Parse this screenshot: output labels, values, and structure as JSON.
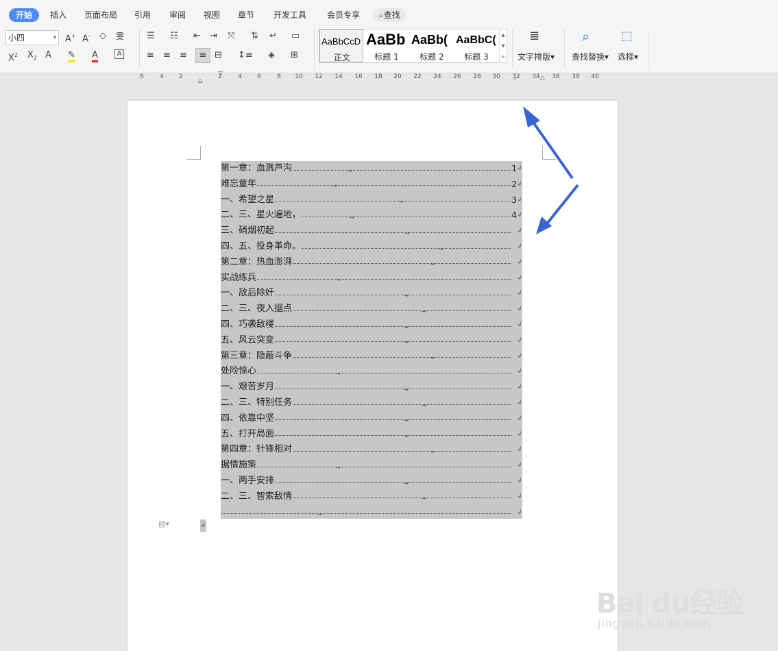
{
  "tabs": [
    {
      "label": "开始",
      "active": true
    },
    {
      "label": "插入"
    },
    {
      "label": "页面布局"
    },
    {
      "label": "引用"
    },
    {
      "label": "审阅"
    },
    {
      "label": "视图"
    },
    {
      "label": "章节"
    },
    {
      "label": "开发工具"
    },
    {
      "label": "会员专享"
    },
    {
      "label": "查找"
    }
  ],
  "ribbon": {
    "font_size_value": "小四",
    "styles": [
      {
        "preview": "AaBbCcD",
        "name": "正文"
      },
      {
        "preview": "AaBb",
        "name": "标题 1"
      },
      {
        "preview": "AaBb(",
        "name": "标题 2"
      },
      {
        "preview": "AaBbC(",
        "name": "标题 3"
      }
    ],
    "text_layout_label": "文字排版",
    "find_replace_label": "查找替换",
    "select_label": "选择"
  },
  "ruler": {
    "numbers": [
      "6",
      "4",
      "2",
      "2",
      "4",
      "6",
      "8",
      "10",
      "12",
      "14",
      "16",
      "18",
      "20",
      "22",
      "24",
      "26",
      "28",
      "30",
      "32",
      "34",
      "36",
      "38",
      "40"
    ]
  },
  "toc": {
    "lines": [
      {
        "text": "第一章：血溅芦沟",
        "page": "1"
      },
      {
        "text": "难忘童年",
        "page": "2"
      },
      {
        "text": "一、希望之星",
        "page": "3"
      },
      {
        "text": "二、三、星火遍地，",
        "page": "4"
      },
      {
        "text": "三、硝烟初起",
        "page": ""
      },
      {
        "text": "四、五、投身革命。",
        "page": ""
      },
      {
        "text": "第二章：热血澎湃",
        "page": ""
      },
      {
        "text": "实战练兵",
        "page": ""
      },
      {
        "text": "一、敌后除奸",
        "page": ""
      },
      {
        "text": "二、三、夜入据点",
        "page": ""
      },
      {
        "text": "四、巧袭敌楼",
        "page": ""
      },
      {
        "text": "五、风云突变",
        "page": ""
      },
      {
        "text": "第三章：隐蔽斗争",
        "page": ""
      },
      {
        "text": "处险惊心",
        "page": ""
      },
      {
        "text": "一、艰苦岁月",
        "page": ""
      },
      {
        "text": "二、三、特别任务",
        "page": ""
      },
      {
        "text": "四、依靠中坚",
        "page": ""
      },
      {
        "text": "五、打开局面",
        "page": ""
      },
      {
        "text": "第四章：针锋相对",
        "page": ""
      },
      {
        "text": "据情施策",
        "page": ""
      },
      {
        "text": "一、两手安排",
        "page": ""
      },
      {
        "text": "二、三、智索敌情",
        "page": ""
      },
      {
        "text": "",
        "page": ""
      }
    ],
    "paragraph_mark": "↲",
    "tab_mark": "→"
  },
  "watermark": {
    "brand": "Bai du经验",
    "url": "jingyan.baidu.com"
  },
  "colors": {
    "accent": "#4e8bf6",
    "selection": "#c7c7c7",
    "arrow": "#3a63d6"
  }
}
